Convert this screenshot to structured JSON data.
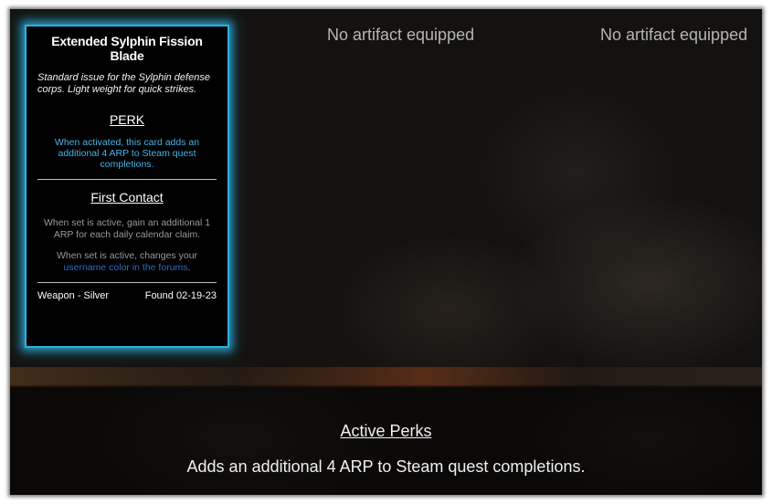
{
  "card": {
    "title": "Extended Sylphin Fission Blade",
    "description": "Standard issue for the Sylphin defense corps. Light weight for quick strikes.",
    "perk_heading": "PERK",
    "perk_text": "When activated, this card adds an additional 4 ARP to Steam quest completions.",
    "set_heading": "First Contact",
    "set_bonus_1": "When set is active, gain an additional 1 ARP for each daily calendar claim.",
    "set_bonus_2_prefix": "When set is active, changes your",
    "set_bonus_2_link": "username color in the forums",
    "set_bonus_2_suffix": ".",
    "type": "Weapon - Silver",
    "found": "Found 02-19-23",
    "accent_color": "#2bb2e0"
  },
  "slots": {
    "slot_1": "No artifact equipped",
    "slot_2": "No artifact equipped"
  },
  "active_perks": {
    "heading": "Active Perks",
    "text": "Adds an additional 4 ARP to Steam quest completions."
  }
}
